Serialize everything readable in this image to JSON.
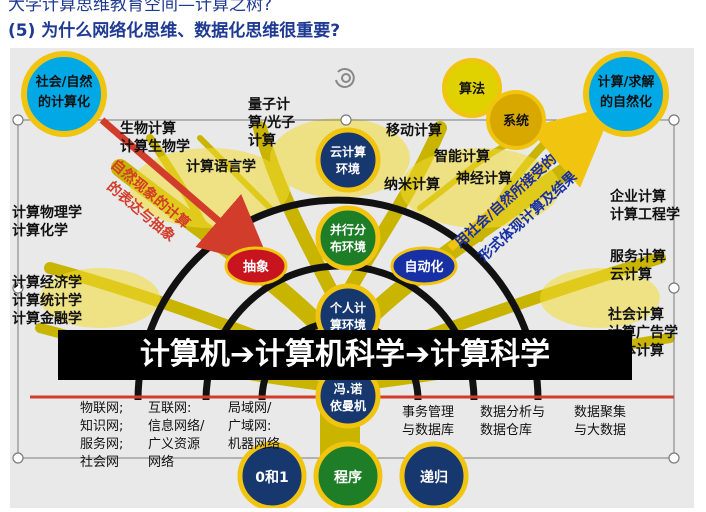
{
  "titles": {
    "line1": "大学计算思维教育空间—计算之树?",
    "line2": "(5) 为什么网络化思维、数据化思维很重要?"
  },
  "banner": "计算机➔计算机科学➔计算科学",
  "circles": {
    "social_computation": [
      "社会/自然",
      "的计算化"
    ],
    "computation_nature": [
      "计算/求解",
      "的自然化"
    ],
    "algorithm": "算法",
    "system": "系统",
    "cloud": [
      "云计算",
      "环境"
    ],
    "parallel": [
      "并行分",
      "布环境"
    ],
    "personal": [
      "个人计",
      "算环境"
    ],
    "von": [
      "冯.诺",
      "依曼机"
    ],
    "zero_one": "0和1",
    "program": "程序",
    "recursion": "递归",
    "abstraction": "抽象",
    "automation": "自动化"
  },
  "arrows": {
    "left_text": [
      "自然现象的计算",
      "的表达与抽象"
    ],
    "right_text": [
      "用社会/自然所接受的",
      "形式体现计算及结果"
    ]
  },
  "fields": {
    "bio": [
      "生物计算",
      "计算生物学"
    ],
    "quantum": [
      "量子计",
      "算/光子",
      "计算"
    ],
    "linguistics": "计算语言学",
    "mobile": "移动计算",
    "intelligent": "智能计算",
    "neural": "神经计算",
    "nano": "纳米计算",
    "physics": [
      "计算物理学",
      "计算化学"
    ],
    "economics": [
      "计算经济学",
      "计算统计学",
      "计算金融学"
    ],
    "enterprise": [
      "企业计算",
      "计算工程学"
    ],
    "service": [
      "服务计算",
      "云计算"
    ],
    "social": [
      "社会计算",
      "计算广告学",
      "媒体计算"
    ]
  },
  "bottom": {
    "col1": [
      "物联网;",
      "知识网;",
      "服务网;",
      "社会网"
    ],
    "col2": [
      "互联网:",
      "信息网络/",
      "广义资源",
      "网络"
    ],
    "col3": [
      "局域网/",
      "广域网:",
      "机器网络"
    ],
    "col4": [
      "事务管理",
      "与数据库"
    ],
    "col5": [
      "数据分析与",
      "数据仓库"
    ],
    "col6": [
      "数据聚集",
      "与大数据"
    ]
  }
}
